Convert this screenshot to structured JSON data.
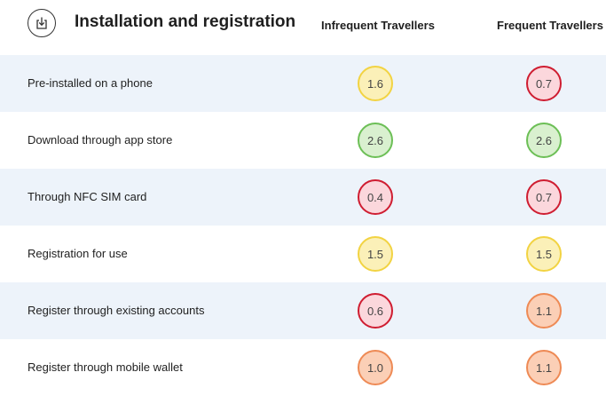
{
  "header": {
    "title": "Installation and registration",
    "icon": "download-icon",
    "columns": [
      "Infrequent Travellers",
      "Frequent Travellers"
    ]
  },
  "rows": [
    {
      "label": "Pre-installed on a phone",
      "infrequent": "1.6",
      "frequent": "0.7",
      "infrequent_color": "yellow",
      "frequent_color": "red"
    },
    {
      "label": "Download through app store",
      "infrequent": "2.6",
      "frequent": "2.6",
      "infrequent_color": "green",
      "frequent_color": "green"
    },
    {
      "label": "Through NFC SIM card",
      "infrequent": "0.4",
      "frequent": "0.7",
      "infrequent_color": "red",
      "frequent_color": "red"
    },
    {
      "label": "Registration for use",
      "infrequent": "1.5",
      "frequent": "1.5",
      "infrequent_color": "yellow",
      "frequent_color": "yellow"
    },
    {
      "label": "Register through existing accounts",
      "infrequent": "0.6",
      "frequent": "1.1",
      "infrequent_color": "red",
      "frequent_color": "orange"
    },
    {
      "label": "Register through mobile wallet",
      "infrequent": "1.0",
      "frequent": "1.1",
      "infrequent_color": "orange",
      "frequent_color": "orange"
    }
  ],
  "colors": {
    "row_shade": "#edf3fa",
    "yellow": "#f2d342",
    "red": "#cf1d31",
    "green": "#6cbf56",
    "orange": "#ee8a55"
  }
}
